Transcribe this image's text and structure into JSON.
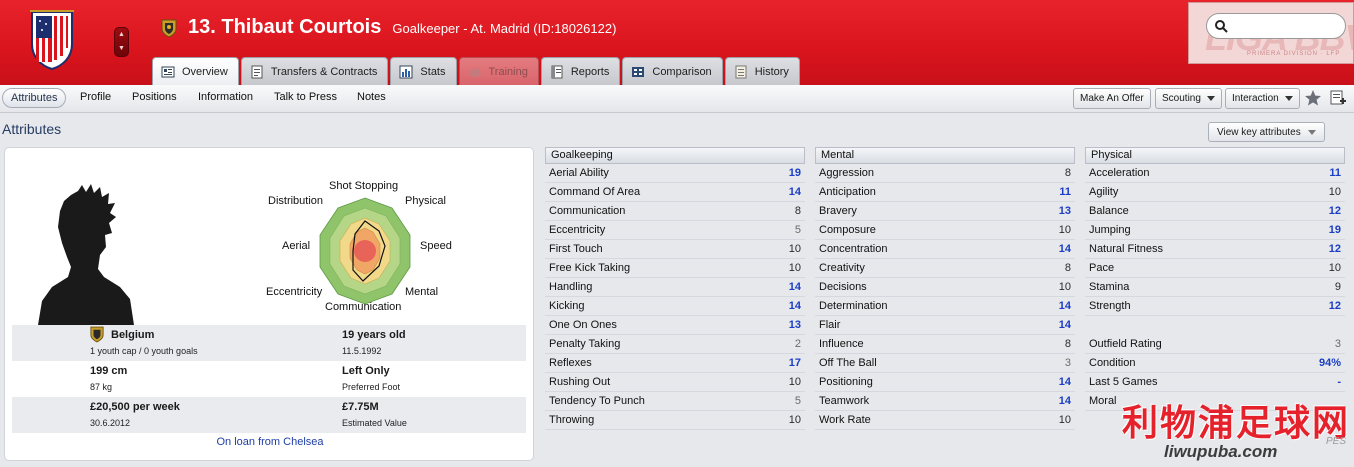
{
  "header": {
    "player_name": "13. Thibaut Courtois",
    "subtitle": "Goalkeeper - At. Madrid (ID:18026122)",
    "colors": {
      "brand": "#d9141c",
      "accent": "#1b3ec4"
    }
  },
  "tabs": [
    {
      "label": "Overview",
      "icon": "overview-icon"
    },
    {
      "label": "Transfers & Contracts",
      "icon": "document-icon"
    },
    {
      "label": "Stats",
      "icon": "bar-chart-icon"
    },
    {
      "label": "Training",
      "icon": "cloud-icon"
    },
    {
      "label": "Reports",
      "icon": "report-icon"
    },
    {
      "label": "Comparison",
      "icon": "comparison-icon"
    },
    {
      "label": "History",
      "icon": "history-icon"
    }
  ],
  "league": {
    "logo_text": "LIGA BBVA",
    "logo_sub": "PRIMERA DIVISION · LFP"
  },
  "subnav": {
    "items": [
      "Attributes",
      "Profile",
      "Positions",
      "Information",
      "Talk to Press",
      "Notes"
    ],
    "make_offer": "Make An Offer",
    "scouting": "Scouting",
    "interaction": "Interaction"
  },
  "content": {
    "title": "Attributes",
    "view_key": "View key attributes",
    "radar_labels": {
      "top": "Shot Stopping",
      "top_right": "Physical",
      "right": "Speed",
      "bottom_right": "Mental",
      "bottom": "Communication",
      "bottom_left": "Eccentricity",
      "left": "Aerial",
      "top_left": "Distribution"
    },
    "facts": {
      "nation": "Belgium",
      "caps": "1 youth cap / 0 youth goals",
      "age": "19 years old",
      "dob": "11.5.1992",
      "height": "199 cm",
      "weight": "87 kg",
      "foot": "Left Only",
      "foot_label": "Preferred Foot",
      "wage": "£20,500 per week",
      "contract_end": "30.6.2012",
      "value": "£7.75M",
      "value_label": "Estimated Value"
    },
    "loan": "On loan from Chelsea"
  },
  "goalkeeping": {
    "title": "Goalkeeping",
    "rows": [
      [
        "Aerial Ability",
        "19"
      ],
      [
        "Command Of Area",
        "14"
      ],
      [
        "Communication",
        "8"
      ],
      [
        "Eccentricity",
        "5"
      ],
      [
        "First Touch",
        "10"
      ],
      [
        "Free Kick Taking",
        "10"
      ],
      [
        "Handling",
        "14"
      ],
      [
        "Kicking",
        "14"
      ],
      [
        "One On Ones",
        "13"
      ],
      [
        "Penalty Taking",
        "2"
      ],
      [
        "Reflexes",
        "17"
      ],
      [
        "Rushing Out",
        "10"
      ],
      [
        "Tendency To Punch",
        "5"
      ],
      [
        "Throwing",
        "10"
      ]
    ]
  },
  "mental": {
    "title": "Mental",
    "rows": [
      [
        "Aggression",
        "8"
      ],
      [
        "Anticipation",
        "11"
      ],
      [
        "Bravery",
        "13"
      ],
      [
        "Composure",
        "10"
      ],
      [
        "Concentration",
        "14"
      ],
      [
        "Creativity",
        "8"
      ],
      [
        "Decisions",
        "10"
      ],
      [
        "Determination",
        "14"
      ],
      [
        "Flair",
        "14"
      ],
      [
        "Influence",
        "8"
      ],
      [
        "Off The Ball",
        "3"
      ],
      [
        "Positioning",
        "14"
      ],
      [
        "Teamwork",
        "14"
      ],
      [
        "Work Rate",
        "10"
      ]
    ]
  },
  "physical": {
    "title": "Physical",
    "rows": [
      [
        "Acceleration",
        "11"
      ],
      [
        "Agility",
        "10"
      ],
      [
        "Balance",
        "12"
      ],
      [
        "Jumping",
        "19"
      ],
      [
        "Natural Fitness",
        "12"
      ],
      [
        "Pace",
        "10"
      ],
      [
        "Stamina",
        "9"
      ],
      [
        "Strength",
        "12"
      ]
    ],
    "extra": [
      [
        "Outfield Rating",
        "3"
      ],
      [
        "Condition",
        "94%"
      ],
      [
        "Last 5 Games",
        "-"
      ],
      [
        "Moral",
        ""
      ]
    ]
  },
  "watermark": {
    "cn": "利物浦足球网",
    "en": "liwupuba.com",
    "pes": "PES"
  }
}
